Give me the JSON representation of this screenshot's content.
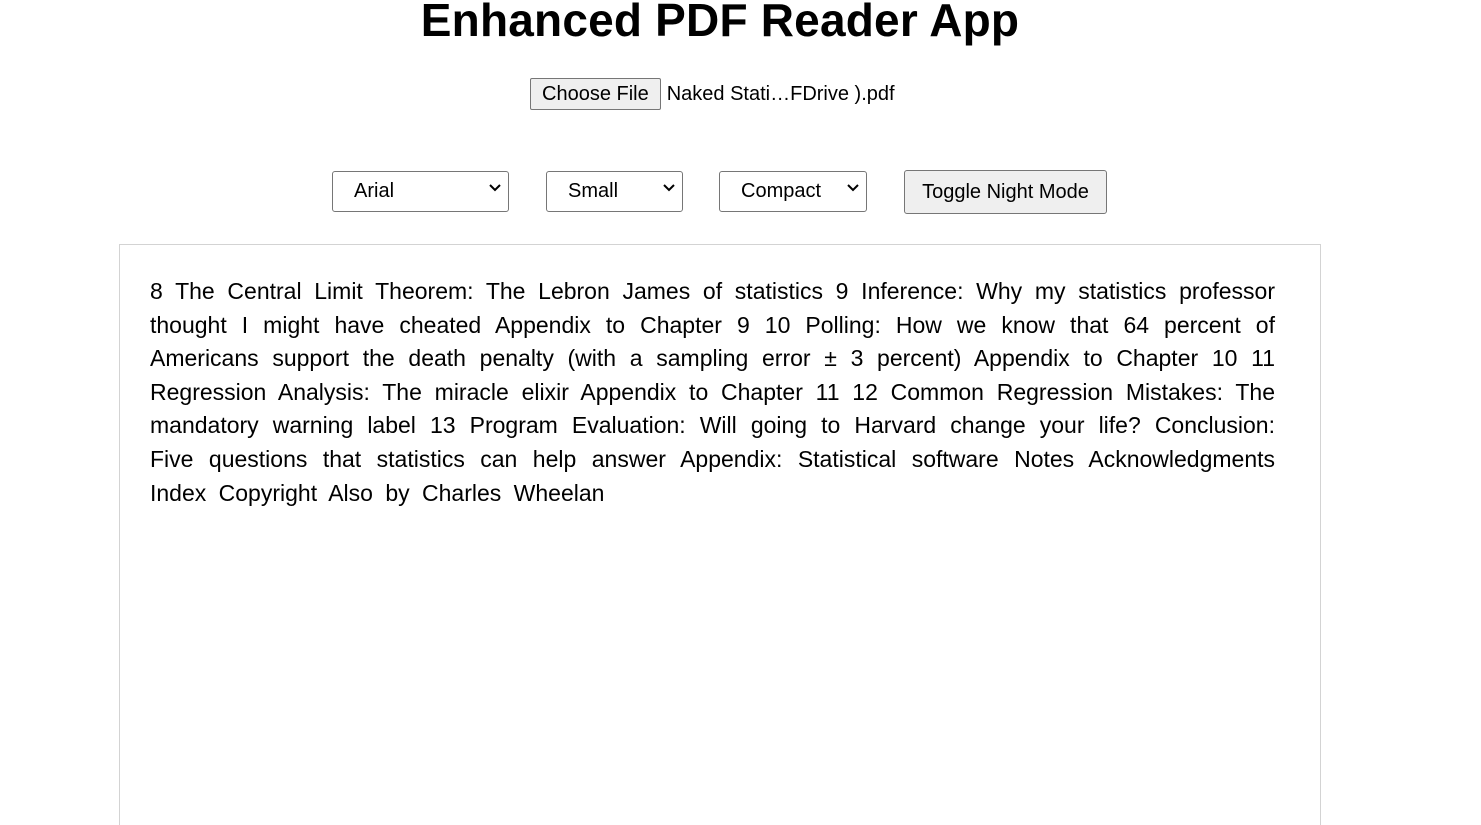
{
  "app": {
    "title": "Enhanced PDF Reader App"
  },
  "file_picker": {
    "button_label": "Choose File",
    "file_name": "Naked Stati…FDrive ).pdf"
  },
  "controls": {
    "font_select": {
      "selected": "Arial"
    },
    "size_select": {
      "selected": "Small"
    },
    "spacing_select": {
      "selected": "Compact"
    },
    "night_mode_button_label": "Toggle Night Mode"
  },
  "reader": {
    "content": "8 The Central Limit Theorem: The Lebron James of statistics 9 Inference: Why my statistics professor thought I might have cheated Appendix to Chapter 9 10 Polling: How we know that 64 percent of Americans support the death penalty (with a sampling error ± 3 percent) Appendix to Chapter 10 11 Regression Analysis: The miracle elixir Appendix to Chapter 11 12 Common Regression Mistakes: The mandatory warning label 13 Program Evaluation: Will going to Harvard change your life? Conclusion: Five questions that statistics can help answer Appendix: Statistical software Notes Acknowledgments Index Copyright Also by Charles Wheelan"
  },
  "icons": {
    "select_arrow": "chevron-down-icon"
  }
}
